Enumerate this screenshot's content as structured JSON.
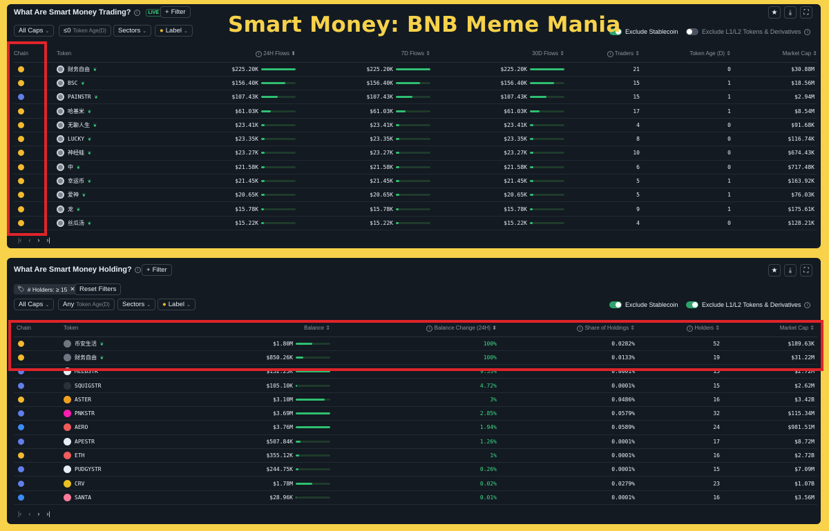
{
  "overlay_title": "Smart Money: BNB Meme Mania",
  "colors": {
    "bnb": "#f3ba2f",
    "eth": "#627eea",
    "base": "#3b8cf5",
    "accent": "#2fbf71",
    "highlight": "#e0242a",
    "bg": "#131a22"
  },
  "trading": {
    "title": "What Are Smart Money Trading?",
    "live": "LIVE",
    "filter": "Filter",
    "filters": {
      "caps": "All Caps",
      "age_prefix": "≤0",
      "age_label": "Token Age(D)",
      "sectors": "Sectors",
      "label": "Label"
    },
    "toggles": {
      "stable": "Exclude Stablecoin",
      "l1l2": "Exclude L1/L2 Tokens & Derivatives"
    },
    "columns": [
      "Chain",
      "Token",
      "24H Flows",
      "7D Flows",
      "30D Flows",
      "Traders",
      "Token Age (D)",
      "Market Cap"
    ],
    "rows": [
      {
        "chain": "bnb",
        "token": "财务自由",
        "f24": "$225.20K",
        "f7": "$225.20K",
        "f30": "$225.20K",
        "bar": 1.0,
        "traders": "21",
        "age": "0",
        "mcap": "$30.88M"
      },
      {
        "chain": "bnb",
        "token": "BSC",
        "f24": "$156.40K",
        "f7": "$156.40K",
        "f30": "$156.40K",
        "bar": 0.69,
        "traders": "15",
        "age": "1",
        "mcap": "$18.56M"
      },
      {
        "chain": "eth",
        "token": "PAINSTR",
        "f24": "$107.43K",
        "f7": "$107.43K",
        "f30": "$107.43K",
        "bar": 0.48,
        "traders": "15",
        "age": "1",
        "mcap": "$2.94M"
      },
      {
        "chain": "bnb",
        "token": "哈基米",
        "f24": "$61.03K",
        "f7": "$61.03K",
        "f30": "$61.03K",
        "bar": 0.27,
        "traders": "17",
        "age": "1",
        "mcap": "$8.54M"
      },
      {
        "chain": "bnb",
        "token": "无聊人生",
        "f24": "$23.41K",
        "f7": "$23.41K",
        "f30": "$23.41K",
        "bar": 0.1,
        "traders": "4",
        "age": "0",
        "mcap": "$91.68K"
      },
      {
        "chain": "bnb",
        "token": "LUCKY",
        "f24": "$23.35K",
        "f7": "$23.35K",
        "f30": "$23.35K",
        "bar": 0.1,
        "traders": "8",
        "age": "0",
        "mcap": "$116.74K"
      },
      {
        "chain": "bnb",
        "token": "神经蛙",
        "f24": "$23.27K",
        "f7": "$23.27K",
        "f30": "$23.27K",
        "bar": 0.1,
        "traders": "10",
        "age": "0",
        "mcap": "$674.43K"
      },
      {
        "chain": "bnb",
        "token": "中",
        "f24": "$21.58K",
        "f7": "$21.58K",
        "f30": "$21.58K",
        "bar": 0.1,
        "traders": "6",
        "age": "0",
        "mcap": "$717.48K"
      },
      {
        "chain": "bnb",
        "token": "幸运币",
        "f24": "$21.45K",
        "f7": "$21.45K",
        "f30": "$21.45K",
        "bar": 0.1,
        "traders": "5",
        "age": "1",
        "mcap": "$163.92K"
      },
      {
        "chain": "bnb",
        "token": "爱神",
        "f24": "$20.65K",
        "f7": "$20.65K",
        "f30": "$20.65K",
        "bar": 0.09,
        "traders": "5",
        "age": "1",
        "mcap": "$76.03K"
      },
      {
        "chain": "bnb",
        "token": "龙",
        "f24": "$15.78K",
        "f7": "$15.78K",
        "f30": "$15.78K",
        "bar": 0.07,
        "traders": "9",
        "age": "1",
        "mcap": "$175.61K"
      },
      {
        "chain": "bnb",
        "token": "丝瓜汤",
        "f24": "$15.22K",
        "f7": "$15.22K",
        "f30": "$15.22K",
        "bar": 0.07,
        "traders": "4",
        "age": "0",
        "mcap": "$128.21K"
      }
    ]
  },
  "holding": {
    "title": "What Are Smart Money Holding?",
    "filter": "Filter",
    "tag": "# Holders: ≥ 15",
    "reset": "Reset Filters",
    "filters": {
      "caps": "All Caps",
      "age_prefix": "Any",
      "age_label": "Token Age(D)",
      "sectors": "Sectors",
      "label": "Label"
    },
    "toggles": {
      "stable": "Exclude Stablecoin",
      "l1l2": "Exclude L1/L2 Tokens & Derivatives"
    },
    "columns": [
      "Chain",
      "Token",
      "Balance",
      "Balance Change (24H)",
      "Share of Holdings",
      "Holders",
      "Market Cap"
    ],
    "rows": [
      {
        "chain": "bnb",
        "token": "币安生活",
        "icon": "#6e7681",
        "balance": "$1.80M",
        "bar": 0.48,
        "change": "100%",
        "share": "0.0282%",
        "holders": "52",
        "mcap": "$189.63K"
      },
      {
        "chain": "bnb",
        "token": "财务自由",
        "icon": "#6e7681",
        "balance": "$850.26K",
        "bar": 0.22,
        "change": "100%",
        "share": "0.0133%",
        "holders": "19",
        "mcap": "$31.22M"
      },
      {
        "chain": "eth",
        "token": "MEEBSTR",
        "icon": "#e6edf3",
        "balance": "$152.25K",
        "bar": 1.0,
        "change": "9.53%",
        "share": "0.0001%",
        "holders": "15",
        "mcap": "$2.72M"
      },
      {
        "chain": "eth",
        "token": "SQUIGSTR",
        "icon": "#2a313a",
        "balance": "$105.10K",
        "bar": 0.03,
        "change": "4.72%",
        "share": "0.0001%",
        "holders": "15",
        "mcap": "$2.62M"
      },
      {
        "chain": "bnb",
        "token": "ASTER",
        "icon": "#f0a020",
        "balance": "$3.10M",
        "bar": 0.83,
        "change": "3%",
        "share": "0.0486%",
        "holders": "16",
        "mcap": "$3.42B"
      },
      {
        "chain": "eth",
        "token": "PNKSTR",
        "icon": "#ff1cb0",
        "balance": "$3.69M",
        "bar": 1.0,
        "change": "2.85%",
        "share": "0.0579%",
        "holders": "32",
        "mcap": "$115.34M"
      },
      {
        "chain": "base",
        "token": "AERO",
        "icon": "#f05a5a",
        "balance": "$3.76M",
        "bar": 1.0,
        "change": "1.94%",
        "share": "0.0589%",
        "holders": "24",
        "mcap": "$981.51M"
      },
      {
        "chain": "eth",
        "token": "APESTR",
        "icon": "#e6edf3",
        "balance": "$507.84K",
        "bar": 0.14,
        "change": "1.26%",
        "share": "0.0001%",
        "holders": "17",
        "mcap": "$8.72M"
      },
      {
        "chain": "bnb",
        "token": "ETH",
        "icon": "#f25c5c",
        "balance": "$355.12K",
        "bar": 0.09,
        "change": "1%",
        "share": "0.0001%",
        "holders": "16",
        "mcap": "$2.72B"
      },
      {
        "chain": "eth",
        "token": "PUDGYSTR",
        "icon": "#e6edf3",
        "balance": "$244.75K",
        "bar": 0.07,
        "change": "0.26%",
        "share": "0.0001%",
        "holders": "15",
        "mcap": "$7.09M"
      },
      {
        "chain": "eth",
        "token": "CRV",
        "icon": "#e8c020",
        "balance": "$1.78M",
        "bar": 0.47,
        "change": "0.02%",
        "share": "0.0279%",
        "holders": "23",
        "mcap": "$1.07B"
      },
      {
        "chain": "base",
        "token": "SANTA",
        "icon": "#ff7a9a",
        "balance": "$28.96K",
        "bar": 0.01,
        "change": "0.01%",
        "share": "0.0001%",
        "holders": "16",
        "mcap": "$3.56M"
      }
    ]
  },
  "icons": [
    "info-icon",
    "plus-icon",
    "star-icon",
    "download-icon",
    "expand-icon",
    "chevron-down-icon",
    "leaf-icon",
    "sort-icon",
    "tag-icon",
    "close-icon",
    "first-page-icon",
    "prev-page-icon",
    "next-page-icon",
    "last-page-icon"
  ],
  "pager": {
    "first": "|‹",
    "prev": "‹",
    "next": "›",
    "last": "›|"
  }
}
